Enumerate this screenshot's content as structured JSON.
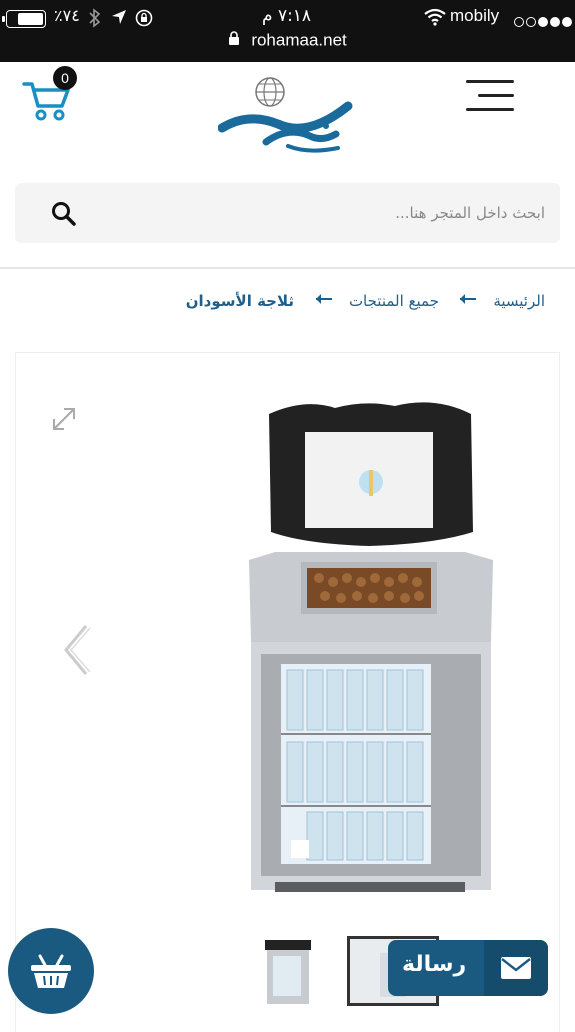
{
  "status_bar": {
    "carrier": "mobily",
    "time": "٧:١٨ م",
    "battery_percent": "٧٤٪",
    "battery_level": 0.74
  },
  "browser": {
    "url": "rohamaa.net"
  },
  "header": {
    "cart_count": "0",
    "logo_alt": "رحماء"
  },
  "search": {
    "placeholder": "ابحث داخل المتجر هنا..."
  },
  "breadcrumb": {
    "home": "الرئيسية",
    "all_products": "جميع المنتجات",
    "current": "ثلاجة الأسودان",
    "separator": "⟵"
  },
  "floating": {
    "message_label": "رسالة"
  },
  "colors": {
    "brand": "#1a5a80",
    "link": "#1f5f8a",
    "status_bar": "#111111"
  },
  "icons": {
    "cart": "cart-icon",
    "menu": "hamburger-icon",
    "search": "search-icon",
    "expand": "expand-icon",
    "prev": "chevron-left-icon",
    "basket": "basket-icon",
    "mail": "mail-icon"
  }
}
